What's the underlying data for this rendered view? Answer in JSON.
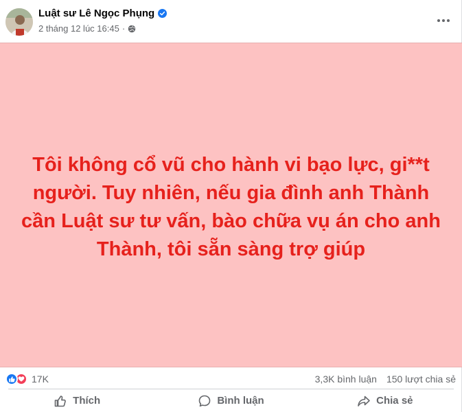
{
  "post": {
    "author": "Luật sư Lê Ngọc Phụng",
    "timestamp": "2 tháng 12 lúc 16:45",
    "separator": "·",
    "privacy_icon": "globe-icon",
    "content_text": "Tôi không cổ vũ cho hành vi bạo lực, gi**t người. Tuy nhiên, nếu gia đình anh Thành cần Luật sư tư vấn, bào chữa vụ án cho anh Thành, tôi sẵn sàng trợ giúp",
    "background_color": "#fdc2c2",
    "text_color": "#e6211c"
  },
  "stats": {
    "reaction_count": "17K",
    "comments": "3,3K bình luận",
    "shares": "150 lượt chia sẻ"
  },
  "actions": {
    "like_label": "Thích",
    "comment_label": "Bình luận",
    "share_label": "Chia sẻ"
  },
  "colors": {
    "like_blue": "#1877f2",
    "love_red": "#f33e58",
    "verified_blue": "#1877f2",
    "secondary_text": "#65676b"
  }
}
